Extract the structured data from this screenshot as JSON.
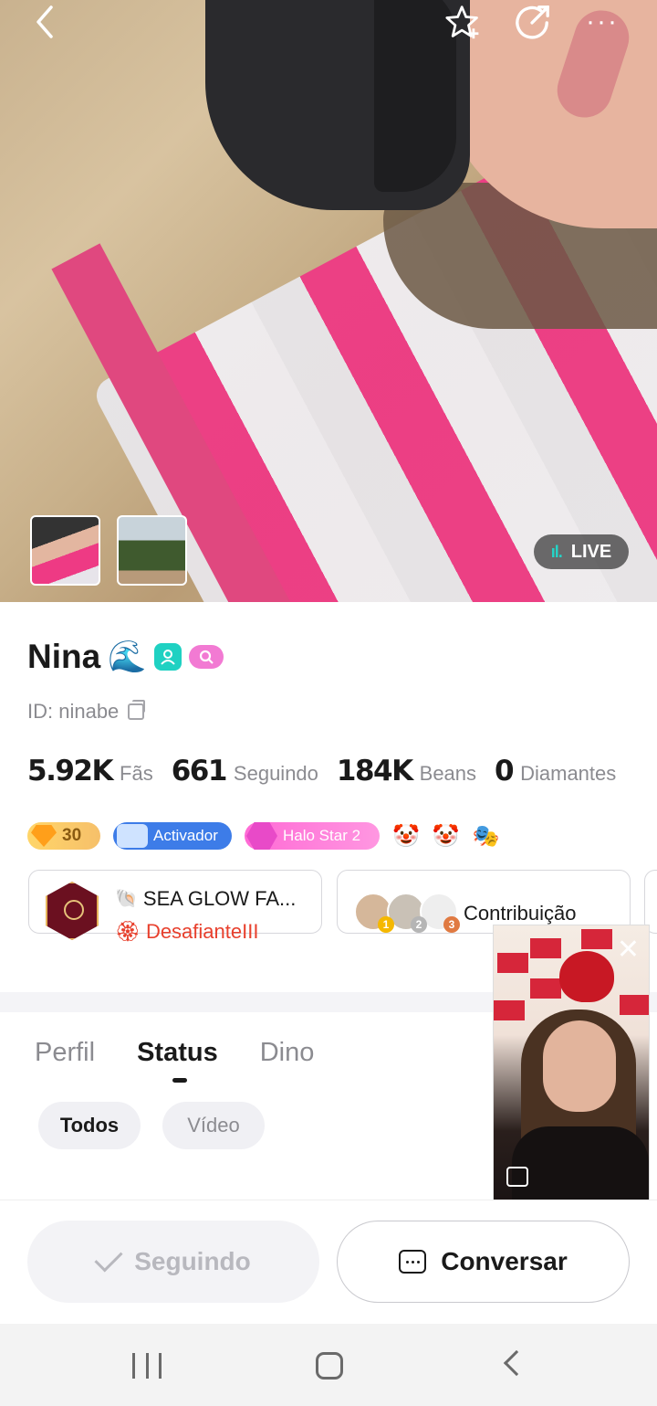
{
  "hero": {
    "live_label": "LIVE",
    "photo_count": 2
  },
  "profile": {
    "name": "Nina",
    "name_emoji": "🌊",
    "id_text": "ID: ninabe",
    "stats": [
      {
        "value": "5.92K",
        "label": "Fãs"
      },
      {
        "value": "661",
        "label": "Seguindo"
      },
      {
        "value": "184K",
        "label": "Beans"
      },
      {
        "value": "0",
        "label": "Diamantes"
      }
    ],
    "badges": {
      "level": "30",
      "activator": "Activador",
      "halo": "Halo Star 2"
    },
    "family": {
      "shell_emoji": "🐚",
      "name": "SEA GLOW FA...",
      "rank_emoji": "🏵",
      "rank": "DesafianteIII"
    },
    "contribution": {
      "label": "Contribuição",
      "ranks": [
        "1",
        "2",
        "3"
      ]
    }
  },
  "tabs": [
    {
      "label": "Perfil",
      "active": false
    },
    {
      "label": "Status",
      "active": true
    },
    {
      "label": "Dino",
      "active": false
    }
  ],
  "filters": [
    {
      "label": "Todos",
      "active": true
    },
    {
      "label": "Vídeo",
      "active": false
    }
  ],
  "actions": {
    "follow_label": "Seguindo",
    "chat_label": "Conversar"
  },
  "colors": {
    "accent_teal": "#1fd1c2",
    "accent_pink": "#f27ad3",
    "rank_red": "#e8402d",
    "live_bar": "#25d3c6"
  }
}
